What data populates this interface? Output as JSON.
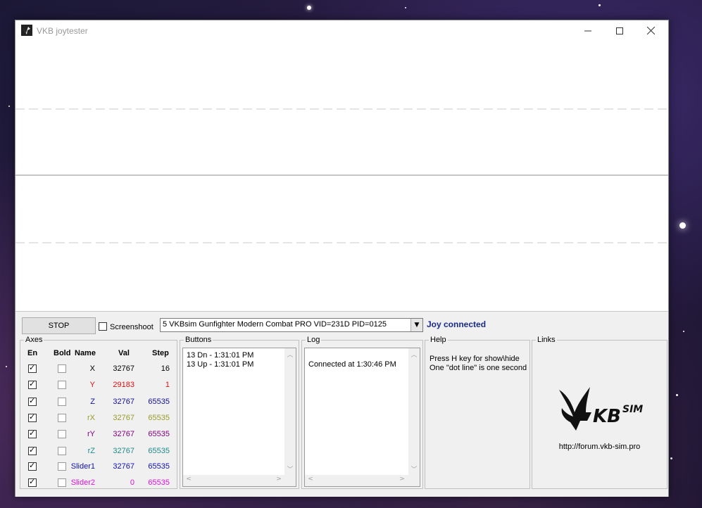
{
  "window": {
    "title": "VKB joytester"
  },
  "controls": {
    "stop_label": "STOP",
    "screenshoot_label": "Screenshoot",
    "screenshoot_checked": false,
    "device_selected": "5 VKBsim Gunfighter Modern Combat PRO  VID=231D PID=0125",
    "joy_status": "Joy connected"
  },
  "axes": {
    "title": "Axes",
    "headers": {
      "en": "En",
      "bold": "Bold",
      "name": "Name",
      "val": "Val",
      "step": "Step"
    },
    "rows": [
      {
        "enabled": true,
        "bold": false,
        "name": "X",
        "val": "32767",
        "step": "16",
        "color": "#000000"
      },
      {
        "enabled": true,
        "bold": false,
        "name": "Y",
        "val": "29183",
        "step": "1",
        "color": "#e01010"
      },
      {
        "enabled": true,
        "bold": false,
        "name": "Z",
        "val": "32767",
        "step": "65535",
        "color": "#101090"
      },
      {
        "enabled": true,
        "bold": false,
        "name": "rX",
        "val": "32767",
        "step": "65535",
        "color": "#9a9a2a"
      },
      {
        "enabled": true,
        "bold": false,
        "name": "rY",
        "val": "32767",
        "step": "65535",
        "color": "#800080"
      },
      {
        "enabled": true,
        "bold": false,
        "name": "rZ",
        "val": "32767",
        "step": "65535",
        "color": "#208a8a"
      },
      {
        "enabled": true,
        "bold": false,
        "name": "Slider1",
        "val": "32767",
        "step": "65535",
        "color": "#1010b0"
      },
      {
        "enabled": true,
        "bold": false,
        "name": "Slider2",
        "val": "0",
        "step": "65535",
        "color": "#e010e0"
      }
    ]
  },
  "buttons_panel": {
    "title": "Buttons",
    "lines": [
      "13 Dn - 1:31:01 PM",
      "13 Up - 1:31:01 PM"
    ]
  },
  "log_panel": {
    "title": "Log",
    "lines": [
      "Connected at 1:30:46 PM"
    ]
  },
  "help_panel": {
    "title": "Help",
    "lines": [
      "Press H key for show\\hide",
      "One \"dot line\" is one second"
    ]
  },
  "links_panel": {
    "title": "Links",
    "logo_text": "VKBSIM",
    "url": "http://forum.vkb-sim.pro"
  },
  "colors": {
    "accent": "#1a2a8a",
    "plot_line": "#c8c8c8"
  }
}
